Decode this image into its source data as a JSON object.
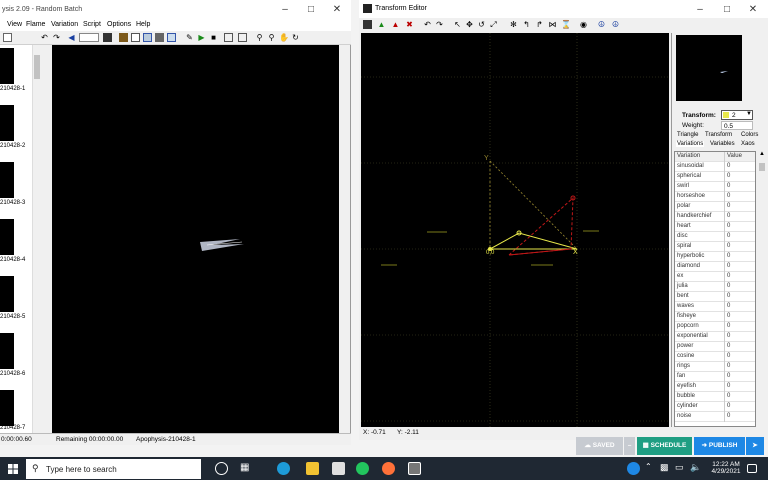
{
  "apophysis": {
    "title": "ysis 2.09 - Random Batch",
    "menu": [
      "View",
      "Flame",
      "Variation",
      "Script",
      "Options",
      "Help"
    ],
    "thumbnails": [
      "210428-1",
      "210428-2",
      "210428-3",
      "210428-4",
      "210428-5",
      "210428-6",
      "210428-7"
    ],
    "status": {
      "elapsed": "0:00:00.60",
      "remaining": "Remaining 00:00:00.00",
      "name": "Apophysis-210428-1"
    }
  },
  "transform_editor": {
    "title": "Transform Editor",
    "transform_label": "Transform:",
    "transform_value": "2",
    "weight_label": "Weight:",
    "weight_value": "0.5",
    "tabs": [
      "Triangle",
      "Transform",
      "Colors",
      "Variations",
      "Variables",
      "Xaos"
    ],
    "table_headers": [
      "Variation",
      "Value"
    ],
    "variations": [
      [
        "sinusoidal",
        "0"
      ],
      [
        "spherical",
        "0"
      ],
      [
        "swirl",
        "0"
      ],
      [
        "horseshoe",
        "0"
      ],
      [
        "polar",
        "0"
      ],
      [
        "handkerchief",
        "0"
      ],
      [
        "heart",
        "0"
      ],
      [
        "disc",
        "0"
      ],
      [
        "spiral",
        "0"
      ],
      [
        "hyperbolic",
        "0"
      ],
      [
        "diamond",
        "0"
      ],
      [
        "ex",
        "0"
      ],
      [
        "julia",
        "0"
      ],
      [
        "bent",
        "0"
      ],
      [
        "waves",
        "0"
      ],
      [
        "fisheye",
        "0"
      ],
      [
        "popcorn",
        "0"
      ],
      [
        "exponential",
        "0"
      ],
      [
        "power",
        "0"
      ],
      [
        "cosine",
        "0"
      ],
      [
        "rings",
        "0"
      ],
      [
        "fan",
        "0"
      ],
      [
        "eyefish",
        "0"
      ],
      [
        "bubble",
        "0"
      ],
      [
        "cylinder",
        "0"
      ],
      [
        "noise",
        "0"
      ]
    ],
    "coords": {
      "x": "X: -0.71",
      "y": "Y: -2.11"
    },
    "canvas_labels": {
      "y": "Y",
      "x": "X",
      "origin": "0,0"
    }
  },
  "publish_bar": {
    "saved": "SAVED",
    "schedule": "SCHEDULE",
    "publish": "PUBLISH"
  },
  "taskbar": {
    "search_placeholder": "Type here to search",
    "time": "12:22 AM",
    "date": "4/29/2021"
  },
  "colors": {
    "accent_teal": "#1f9e83",
    "accent_blue": "#1e88e5",
    "taskbar": "#1f2833"
  }
}
